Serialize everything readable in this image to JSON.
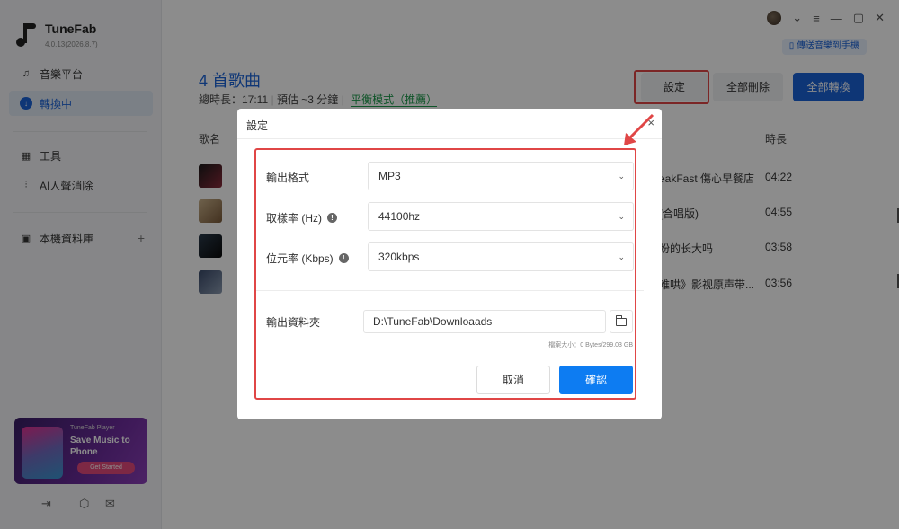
{
  "app": {
    "name": "TuneFab",
    "version": "4.0.13(2026.8.7)"
  },
  "sidebar": {
    "items": [
      {
        "label": "音樂平台",
        "icon": "headphones-icon"
      },
      {
        "label": "轉換中",
        "icon": "download-circle-icon"
      },
      {
        "label": "工具",
        "icon": "grid-icon"
      },
      {
        "label": "AI人聲消除",
        "icon": "waveform-icon"
      },
      {
        "label": "本機資料庫",
        "icon": "library-icon"
      }
    ],
    "add": "+"
  },
  "promo": {
    "small": "TuneFab Player",
    "title": "Save Music to Phone",
    "button": "Get Started"
  },
  "topbar": {
    "transfer_label": "傳送音樂到手機"
  },
  "header": {
    "song_count": "4 首歌曲",
    "total_label": "總時長：17:11",
    "estimate_label": "預估 ~3 分鐘",
    "mode_label": "平衡模式（推薦）",
    "settings_button": "設定",
    "delete_all_button": "全部刪除",
    "convert_all_button": "全部轉換"
  },
  "table": {
    "col_name": "歌名",
    "col_duration": "時長",
    "rows": [
      {
        "title": "eakFast 傷心早餐店",
        "duration": "04:22"
      },
      {
        "title": "(合唱版)",
        "duration": "04:55"
      },
      {
        "title": "盼的长大吗",
        "duration": "03:58"
      },
      {
        "title": "难哄》影视原声带...",
        "duration": "03:56"
      }
    ]
  },
  "dialog": {
    "title": "設定",
    "close": "×",
    "format_label": "輸出格式",
    "format_value": "MP3",
    "samplerate_label": "取樣率 (Hz)",
    "samplerate_value": "44100hz",
    "bitrate_label": "位元率 (Kbps)",
    "bitrate_value": "320kbps",
    "folder_label": "輸出資料夾",
    "folder_value": "D:\\TuneFab\\Downloaads",
    "filesize": "檔案大小：0 Bytes/299.03 GB",
    "cancel": "取消",
    "confirm": "確認"
  },
  "colors": {
    "accent": "#1a63d8",
    "confirm": "#0d7cf2",
    "annotation": "#e04646",
    "mode": "#1b9a4a"
  }
}
